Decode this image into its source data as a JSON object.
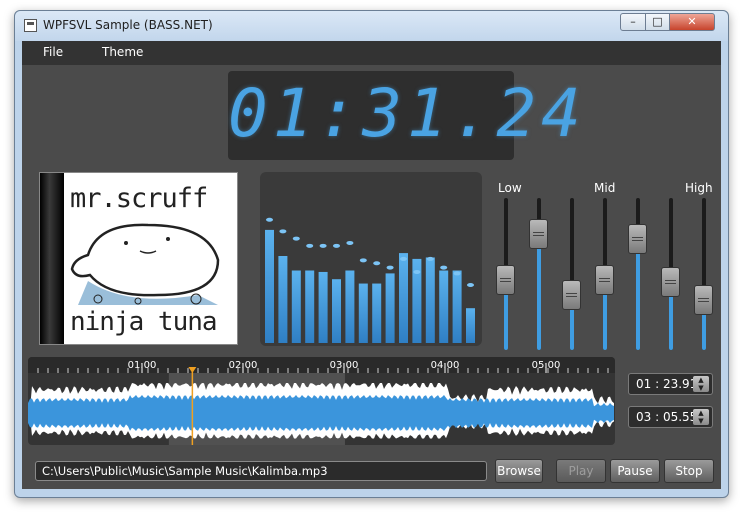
{
  "window": {
    "title": "WPFSVL Sample (BASS.NET)",
    "minimize_glyph": "–",
    "maximize_glyph": "□",
    "close_glyph": "✕"
  },
  "menu": [
    {
      "label": "File"
    },
    {
      "label": "Theme"
    }
  ],
  "clock": {
    "display": "01:31.24"
  },
  "album": {
    "text_top": "mr.scruff",
    "text_bottom": "ninja tuna"
  },
  "spectrum": {
    "levels": [
      0.78,
      0.6,
      0.5,
      0.5,
      0.49,
      0.44,
      0.5,
      0.41,
      0.41,
      0.48,
      0.62,
      0.58,
      0.59,
      0.5,
      0.5,
      0.24
    ],
    "peaks": [
      0.85,
      0.77,
      0.72,
      0.67,
      0.67,
      0.67,
      0.69,
      0.57,
      0.55,
      0.52,
      0.58,
      0.49,
      0.58,
      0.52,
      0.48,
      0.4
    ]
  },
  "equalizer": {
    "labels": {
      "low": "Low",
      "mid": "Mid",
      "high": "High"
    },
    "bands": [
      0.46,
      0.76,
      0.36,
      0.46,
      0.73,
      0.45,
      0.33
    ]
  },
  "timeline": {
    "ticks": [
      "01:00",
      "02:00",
      "03:00",
      "04:00",
      "05:00"
    ],
    "selection": [
      0.24,
      0.54
    ],
    "playhead": 0.28
  },
  "position": {
    "current": "01 : 23.91",
    "total": "03 : 05.55"
  },
  "file_path": "C:\\Users\\Public\\Music\\Sample Music\\Kalimba.mp3",
  "buttons": {
    "browse": "Browse",
    "play": "Play",
    "pause": "Pause",
    "stop": "Stop"
  },
  "colors": {
    "accent": "#4aa3e3",
    "background": "#4b4b4b",
    "menubar": "#333333"
  }
}
